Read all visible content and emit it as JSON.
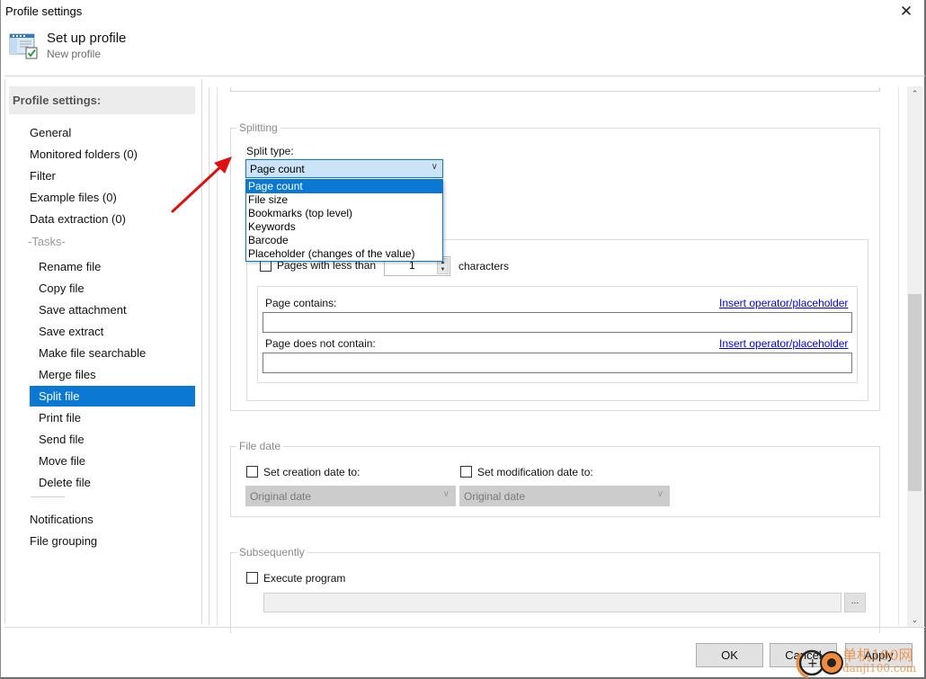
{
  "window": {
    "title": "Profile settings",
    "close_label": "✕"
  },
  "header": {
    "title": "Set up profile",
    "subtitle": "New profile",
    "icon": "profile-settings-icon"
  },
  "sidebar": {
    "heading": "Profile settings:",
    "top_items": [
      {
        "label": "General"
      },
      {
        "label": "Monitored folders (0)"
      },
      {
        "label": "Filter"
      },
      {
        "label": "Example files (0)"
      },
      {
        "label": "Data extraction (0)"
      }
    ],
    "tasks_label": "-Tasks-",
    "tasks": [
      {
        "label": "Rename file"
      },
      {
        "label": "Copy file"
      },
      {
        "label": "Save attachment"
      },
      {
        "label": "Save extract"
      },
      {
        "label": "Make file searchable"
      },
      {
        "label": "Merge files"
      },
      {
        "label": "Split file",
        "selected": true
      },
      {
        "label": "Print file"
      },
      {
        "label": "Send file"
      },
      {
        "label": "Move file"
      },
      {
        "label": "Delete file"
      }
    ],
    "bottom_items": [
      {
        "label": "Notifications"
      },
      {
        "label": "File grouping"
      }
    ],
    "selected_color": "#0b78d4"
  },
  "splitting": {
    "legend": "Splitting",
    "split_type_label": "Split type:",
    "split_type_value": "Page count",
    "split_type_options": [
      "Page count",
      "File size",
      "Bookmarks (top level)",
      "Keywords",
      "Barcode",
      "Placeholder (changes of the value)"
    ],
    "pages_less_than_label": "Pages with less than",
    "pages_less_than_value": "1",
    "characters_label": "characters",
    "page_contains_label": "Page contains:",
    "page_contains_value": "",
    "page_not_contain_label": "Page does not contain:",
    "page_not_contain_value": "",
    "insert_link": "Insert operator/placeholder"
  },
  "file_date": {
    "legend": "File date",
    "creation_label": "Set creation date to:",
    "creation_value": "Original date",
    "modification_label": "Set modification date to:",
    "modification_value": "Original date"
  },
  "subsequently": {
    "legend": "Subsequently",
    "execute_label": "Execute program",
    "program_value": "",
    "browse_label": "..."
  },
  "buttons": {
    "ok": "OK",
    "cancel": "Cancel",
    "apply": "Apply"
  },
  "watermark": {
    "line1": "单机100网",
    "line2": "danji100.com"
  },
  "colors": {
    "accent": "#0b78d4",
    "combo_bg": "#cce4f7",
    "link": "#0000ee"
  }
}
